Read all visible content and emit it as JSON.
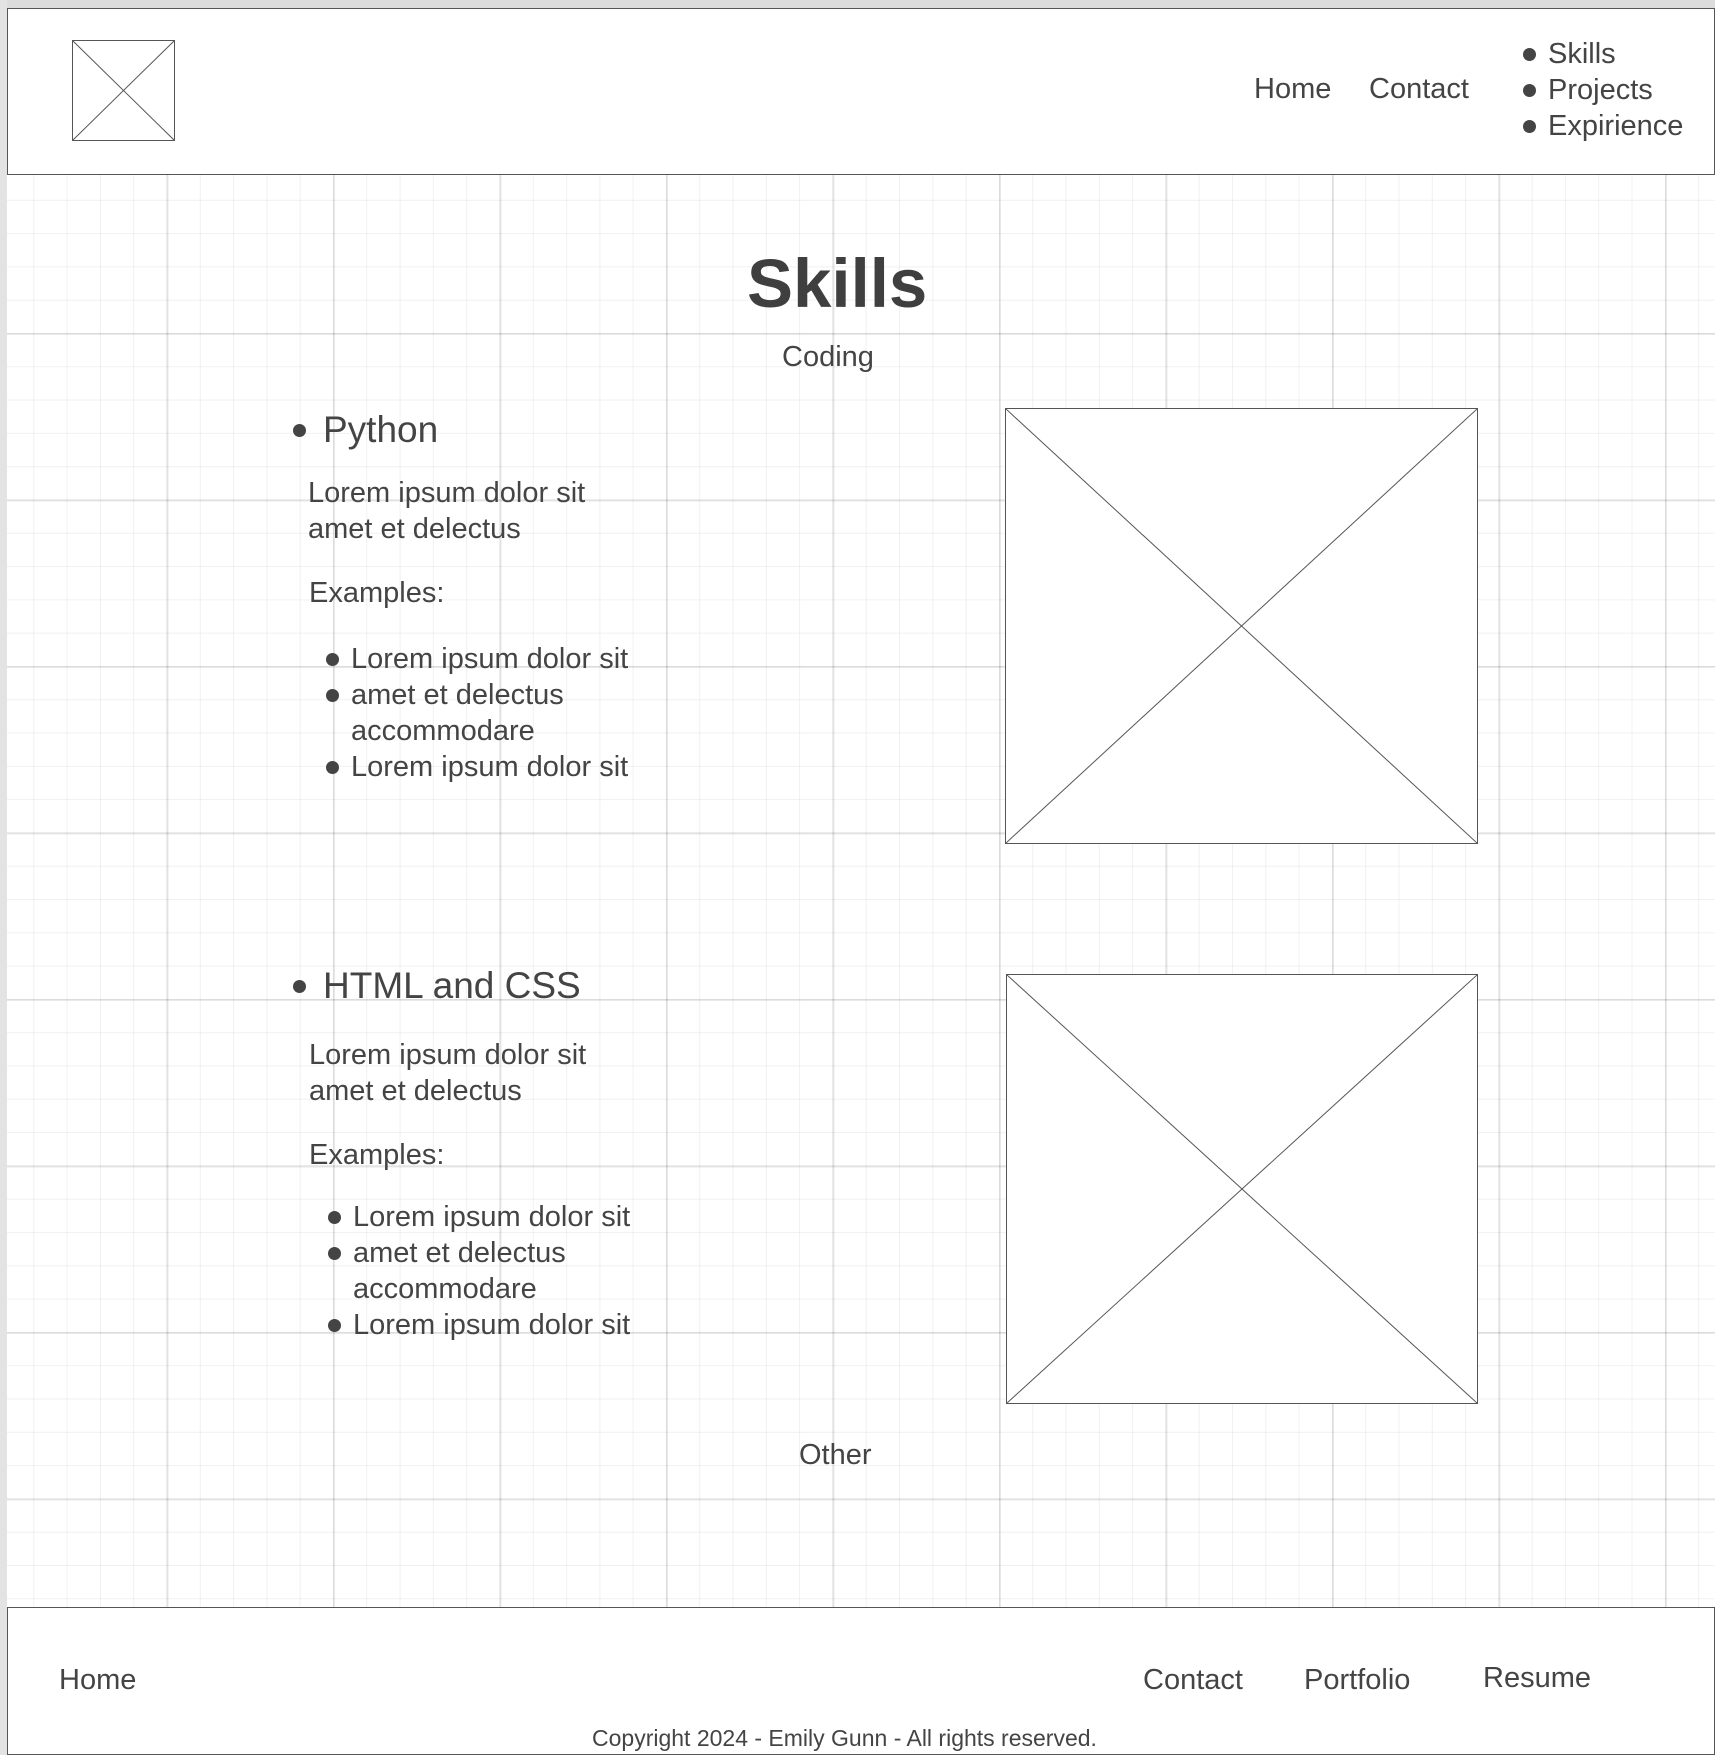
{
  "header": {
    "nav": {
      "home": "Home",
      "contact": "Contact"
    },
    "menu": [
      "Skills",
      "Projects",
      "Expirience"
    ]
  },
  "page": {
    "title": "Skills",
    "coding_label": "Coding",
    "other_label": "Other"
  },
  "skills": [
    {
      "name": "HTML and CSS",
      "description": [
        "Lorem ipsum dolor sit",
        "amet et delectus"
      ],
      "examples_label": "Examples:",
      "examples": [
        "Lorem ipsum dolor sit",
        "amet et delectus",
        "accommodare",
        "Lorem ipsum dolor sit"
      ]
    }
  ],
  "python": {
    "name": "Python",
    "description": [
      "Lorem ipsum dolor sit",
      "amet et delectus"
    ],
    "examples_label": "Examples:",
    "examples": [
      "Lorem ipsum dolor sit",
      "amet et delectus",
      "accommodare",
      "Lorem ipsum dolor sit"
    ]
  },
  "footer": {
    "home": "Home",
    "contact": "Contact",
    "portfolio": "Portfolio",
    "resume": "Resume",
    "copyright": "Copyright 2024 - Emily Gunn - All rights reserved."
  }
}
